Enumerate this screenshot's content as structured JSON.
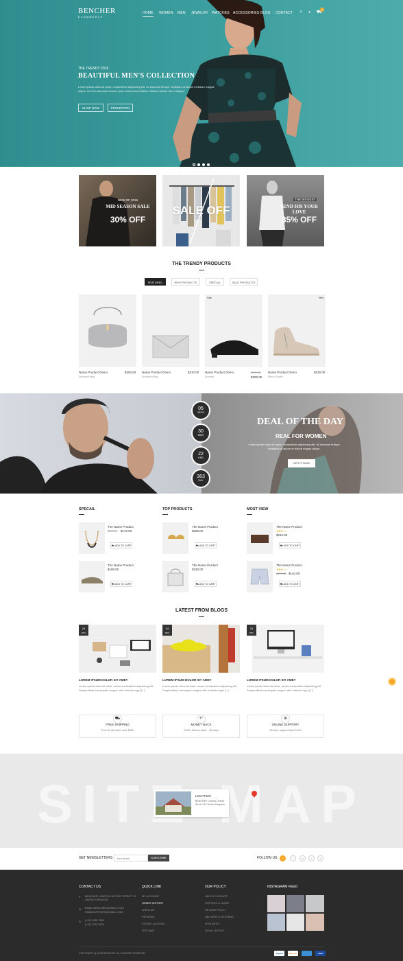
{
  "nav": {
    "logo": "BENCHER",
    "logo_sub": "ECOMMERCE",
    "items": [
      "HOME",
      "WOMEN",
      "MEN",
      "JEWELRY",
      "WATCHES",
      "ACCESSORIES",
      "BLOG",
      "CONTACT"
    ],
    "cart_count": "0"
  },
  "hero": {
    "eyebrow": "THE TRENDY 2016",
    "title": "BEAUTIFUL MEN'S COLLECTION",
    "text": "Lorem ipsum dolor sit amet, consectetur adipisicing elit, do eiusmod tempor incididunt ut labore et dolore magna aliqua. Ut enim adminim veniam, quis nostrud exercitation ullamco laboris nisi ut aliquip.",
    "btn_shop": "SHOP NOW",
    "btn_promo": "PROMOTION"
  },
  "promos": [
    {
      "small": "NEW OF 2016",
      "title": "MID SEASON SALE",
      "offer": "30% OFF"
    },
    {
      "title": "SALE OFF"
    },
    {
      "small": "THE BIGGEST",
      "title": "SEND HIS YOUR LOVE",
      "offer": "35% OFF"
    }
  ],
  "trendy": {
    "title": "THE TRENDY PRODUCTS",
    "tabs": [
      "FEATURED",
      "NEW PRODUCTS",
      "SPECIAL",
      "SALE PRODUCTS"
    ],
    "products": [
      {
        "name": "Name Product Demo",
        "cat": "Women's Bag",
        "price": "$250.00",
        "old": "",
        "badge": ""
      },
      {
        "name": "Name Product Demo",
        "cat": "Women's Bag",
        "price": "$210.00",
        "old": "",
        "badge": ""
      },
      {
        "name": "Name Product Demo",
        "cat": "Women",
        "price": "$200.00",
        "old": "$270.00",
        "badge": "Sale"
      },
      {
        "name": "Name Product Demo",
        "cat": "Men's Shoes",
        "price": "$130.00",
        "old": "",
        "badge": "New"
      }
    ]
  },
  "deal": {
    "countdown": [
      {
        "n": "05",
        "u": "SECS"
      },
      {
        "n": "30",
        "u": "MINS"
      },
      {
        "n": "22",
        "u": "HRS"
      },
      {
        "n": "363",
        "u": "DAY"
      }
    ],
    "title": "DEAL OF THE DAY",
    "subtitle": "REAL FOR WOMEN",
    "text": "Lorem ipsum dolor sit amet, consectetur adipisicing elit, do eiusmod tempor incididunt ut labore et dolore magna aliqua.",
    "button": "GET IT NOW"
  },
  "lists": {
    "special": {
      "title": "SPECAIL",
      "items": [
        {
          "name": "The Name Product",
          "old": "$200.00",
          "price": "$170.00",
          "btn": "ADD TO CART"
        },
        {
          "name": "The Name Product",
          "price": "$190.00",
          "btn": "ADD TO CART"
        }
      ]
    },
    "top": {
      "title": "TOP PRODUCTS",
      "items": [
        {
          "name": "The Name Product",
          "price": "$180.00",
          "btn": "ADD TO CART"
        },
        {
          "name": "The Name Product",
          "price": "$220.00",
          "btn": "ADD TO CART"
        }
      ]
    },
    "most": {
      "title": "MOST VIEW",
      "items": [
        {
          "name": "The Name Product",
          "stars": "★★★☆☆",
          "price": "$215.00",
          "btn": "ADD TO CART"
        },
        {
          "name": "The Name Product",
          "stars": "★★★☆☆",
          "old": "$170.00",
          "price": "$140.00",
          "btn": "ADD TO CART"
        }
      ]
    }
  },
  "blogs": {
    "title": "LATEST FROM BLOGS",
    "posts": [
      {
        "day": "24",
        "mon": "NOV",
        "title": "LOREM IPSUM DOLOR SIT AMET",
        "text": "Lorem ipsum dolor sit amet, nexus consectetur adipiscing elit Suspendisse consequat congue nibh vehicles eget [...]"
      },
      {
        "day": "24",
        "mon": "NOV",
        "title": "LOREM IPSUM DOLOR SIT AMET",
        "text": "Lorem ipsum dolor sit amet, nexus consectetur adipiscing elit Suspendisse consequat congue nibh vehicles eget [...]"
      },
      {
        "day": "24",
        "mon": "NOV",
        "title": "LOREM IPSUM DOLOR SIT AMET",
        "text": "Lorem ipsum dolor sit amet, nexus consectetur adipiscing elit Suspendisse consequat congue nibh vehicles eget [...]"
      }
    ]
  },
  "features": [
    {
      "title": "FREE SHIPPING",
      "desc": "Free fix all order over $300"
    },
    {
      "title": "MONEY BACK",
      "desc": "100% Money back - 45 days"
    },
    {
      "title": "ONLINE SUPPORT",
      "desc": "Service support fast 24/24"
    }
  ],
  "map": {
    "bg_text": "SITE MAP",
    "loc_title": "LOCATION",
    "loc_text": "BENCHEF London Oxford Street 012 United Kingdom"
  },
  "newsletter": {
    "label": "GET NEWSLETTERS",
    "placeholder": "Your email",
    "button": "SUBSCRIBE",
    "follow": "FOLLOW US"
  },
  "footer": {
    "contact": {
      "title": "CONTACT US",
      "address": "BENCHER LONDON OXFORD STREET 12 UNITED KINGDOM",
      "email1": "EMAIL:BENCHER@GMAIL.COM",
      "email2": "EMAILSUPPORT@GMAIL.COM",
      "phone1": "(+92) 3456 7890",
      "phone2": "(+92) 1234 5678"
    },
    "quick": {
      "title": "QUICK LINK",
      "links": [
        "MY ACCOUNT",
        "ORDER HISTORY",
        "WISH LIST",
        "RETURNS",
        "STORE LOCATION",
        "SITE MAP"
      ]
    },
    "policy": {
      "title": "OUR POLICY",
      "links": [
        "HELP & CONTACT",
        "SHIPPING & TAXES",
        "RETURN POLICY",
        "DELIVERY & RETURNS",
        "AFFILIATES",
        "LEGAL NOTICE"
      ]
    },
    "instagram": {
      "title": "INSTAGRAM FEED"
    },
    "copyright": "COPYRIGHT @ 2015 BENCHER. ALL RIGHTS RESERVED.",
    "payments": [
      "PayPal",
      "discover",
      "",
      "VISA"
    ]
  },
  "colors": {
    "accent": "#f5a623",
    "hero": "#36979a",
    "footer": "#2b2b2b"
  }
}
